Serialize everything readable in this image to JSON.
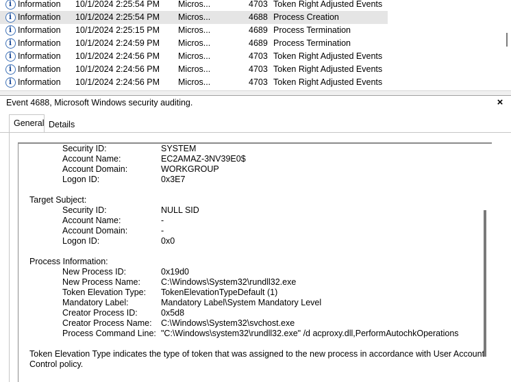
{
  "events": [
    {
      "level": "Information",
      "date": "10/1/2024 2:25:54 PM",
      "source": "Micros...",
      "id": "4703",
      "task": "Token Right Adjusted Events"
    },
    {
      "level": "Information",
      "date": "10/1/2024 2:25:54 PM",
      "source": "Micros...",
      "id": "4688",
      "task": "Process Creation"
    },
    {
      "level": "Information",
      "date": "10/1/2024 2:25:15 PM",
      "source": "Micros...",
      "id": "4689",
      "task": "Process Termination"
    },
    {
      "level": "Information",
      "date": "10/1/2024 2:24:59 PM",
      "source": "Micros...",
      "id": "4689",
      "task": "Process Termination"
    },
    {
      "level": "Information",
      "date": "10/1/2024 2:24:56 PM",
      "source": "Micros...",
      "id": "4703",
      "task": "Token Right Adjusted Events"
    },
    {
      "level": "Information",
      "date": "10/1/2024 2:24:56 PM",
      "source": "Micros...",
      "id": "4703",
      "task": "Token Right Adjusted Events"
    },
    {
      "level": "Information",
      "date": "10/1/2024 2:24:56 PM",
      "source": "Micros...",
      "id": "4703",
      "task": "Token Right Adjusted Events"
    }
  ],
  "selected_event_index": 1,
  "detail": {
    "title": "Event 4688, Microsoft Windows security auditing.",
    "close_label": "×",
    "tabs": [
      "General",
      "Details"
    ],
    "active_tab": "General",
    "subject": {
      "security_id_label": "Security ID:",
      "security_id": "SYSTEM",
      "account_name_label": "Account Name:",
      "account_name": "EC2AMAZ-3NV39E0$",
      "account_domain_label": "Account Domain:",
      "account_domain": "WORKGROUP",
      "logon_id_label": "Logon ID:",
      "logon_id": "0x3E7"
    },
    "target_subject": {
      "header": "Target Subject:",
      "security_id_label": "Security ID:",
      "security_id": "NULL SID",
      "account_name_label": "Account Name:",
      "account_name": "-",
      "account_domain_label": "Account Domain:",
      "account_domain": "-",
      "logon_id_label": "Logon ID:",
      "logon_id": "0x0"
    },
    "process_information": {
      "header": "Process Information:",
      "new_process_id_label": "New Process ID:",
      "new_process_id": "0x19d0",
      "new_process_name_label": "New Process Name:",
      "new_process_name": "C:\\Windows\\System32\\rundll32.exe",
      "token_elevation_type_label": "Token Elevation Type:",
      "token_elevation_type": "TokenElevationTypeDefault (1)",
      "mandatory_label_label": "Mandatory Label:",
      "mandatory_label": "Mandatory Label\\System Mandatory Level",
      "creator_process_id_label": "Creator Process ID:",
      "creator_process_id": "0x5d8",
      "creator_process_name_label": "Creator Process Name:",
      "creator_process_name": "C:\\Windows\\System32\\svchost.exe",
      "process_command_line_label": "Process Command Line:",
      "process_command_line": "\"C:\\Windows\\system32\\rundll32.exe\" /d acproxy.dll,PerformAutochkOperations"
    },
    "footer_line1": "Token Elevation Type indicates the type of token that was assigned to the new process in accordance with User Account",
    "footer_line2": "Control policy."
  }
}
